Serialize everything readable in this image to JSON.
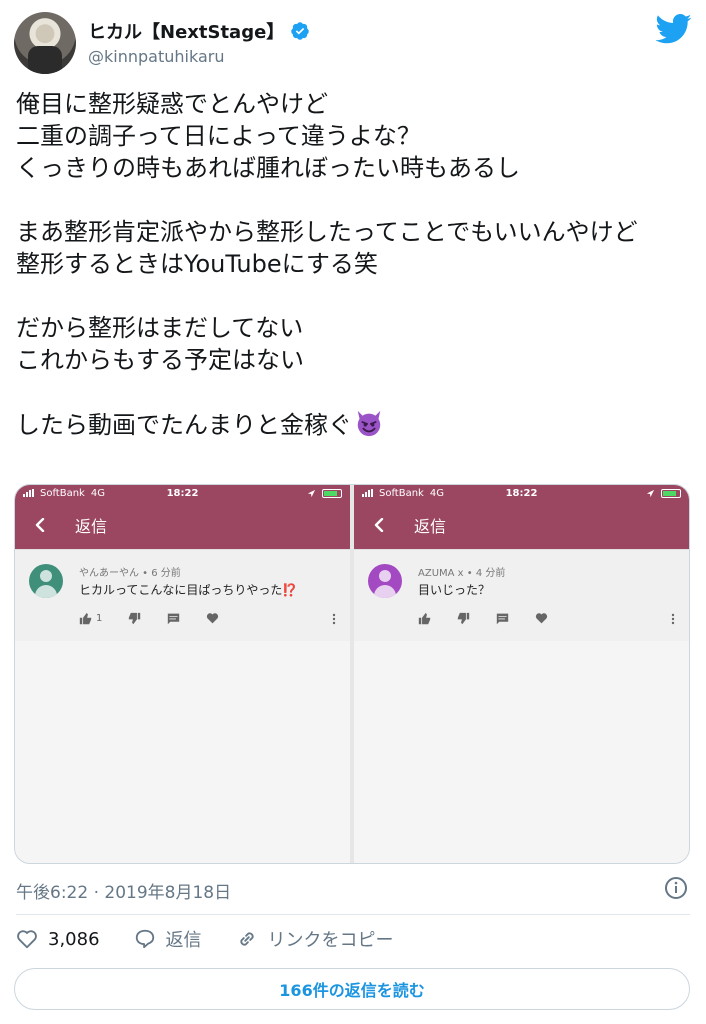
{
  "header": {
    "display_name": "ヒカル【NextStage】",
    "handle": "@kinnpatuhikaru",
    "verified_color": "#1da1f2",
    "brand_icon": "twitter-icon",
    "brand_color": "#1da1f2"
  },
  "tweet": {
    "lines": [
      "俺目に整形疑惑でとんやけど",
      "二重の調子って日によって違うよな？",
      "くっきりの時もあれば腫れぼったい時もあるし",
      "",
      "まあ整形肯定派やから整形したってことでもいいんやけど",
      "整形するときはYouTubeにする笑",
      "",
      "だから整形はまだしてない",
      "これからもする予定はない",
      "",
      "したら動画でたんまりと金稼ぐ"
    ],
    "emoji": "smiling-face-with-horns"
  },
  "media": {
    "screens": [
      {
        "carrier": "SoftBank",
        "network": "4G",
        "time": "18:22",
        "appbar_title": "返信",
        "comment_meta": "やんあーやん • 6 分前",
        "comment_text": "ヒカルってこんなに目ぱっちりやった⁉️",
        "like_count": "1",
        "avatar_color": "#3f8f7a"
      },
      {
        "carrier": "SoftBank",
        "network": "4G",
        "time": "18:22",
        "appbar_title": "返信",
        "comment_meta": "AZUMA x • 4 分前",
        "comment_text": "目いじった？",
        "like_count": "",
        "avatar_color": "#a34ac2"
      }
    ],
    "appbar_color": "#9b4762"
  },
  "timestamp": "午後6:22 · 2019年8月18日",
  "actions": {
    "like_count": "3,086",
    "reply_label": "返信",
    "copy_link_label": "リンクをコピー"
  },
  "replies_button": "166件の返信を読む"
}
